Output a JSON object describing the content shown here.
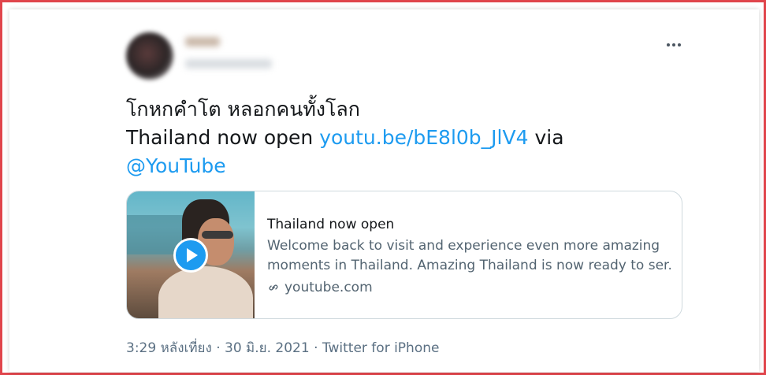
{
  "tweet": {
    "text_line1": "โกหกคำโต หลอกคนทั้งโลก",
    "text_line2_prefix": "Thailand now open ",
    "link_url": "youtu.be/bE8l0b_JlV4",
    "text_via": " via",
    "mention": "@YouTube"
  },
  "card": {
    "title": "Thailand now open",
    "description_line1": "Welcome back to visit and experience even more amazing",
    "description_line2": "moments in Thailand. Amazing Thailand is now ready to ser...",
    "domain": "youtube.com",
    "media": "video-thumbnail"
  },
  "meta": {
    "time": "3:29 หลังเที่ยง",
    "separator": " · ",
    "date": "30 มิ.ย. 2021",
    "source": "Twitter for iPhone"
  },
  "icons": {
    "more": "more-horizontal-icon",
    "play": "play-icon",
    "link": "link-icon"
  },
  "colors": {
    "accent": "#1d9bf0",
    "frame": "#e0454c"
  }
}
